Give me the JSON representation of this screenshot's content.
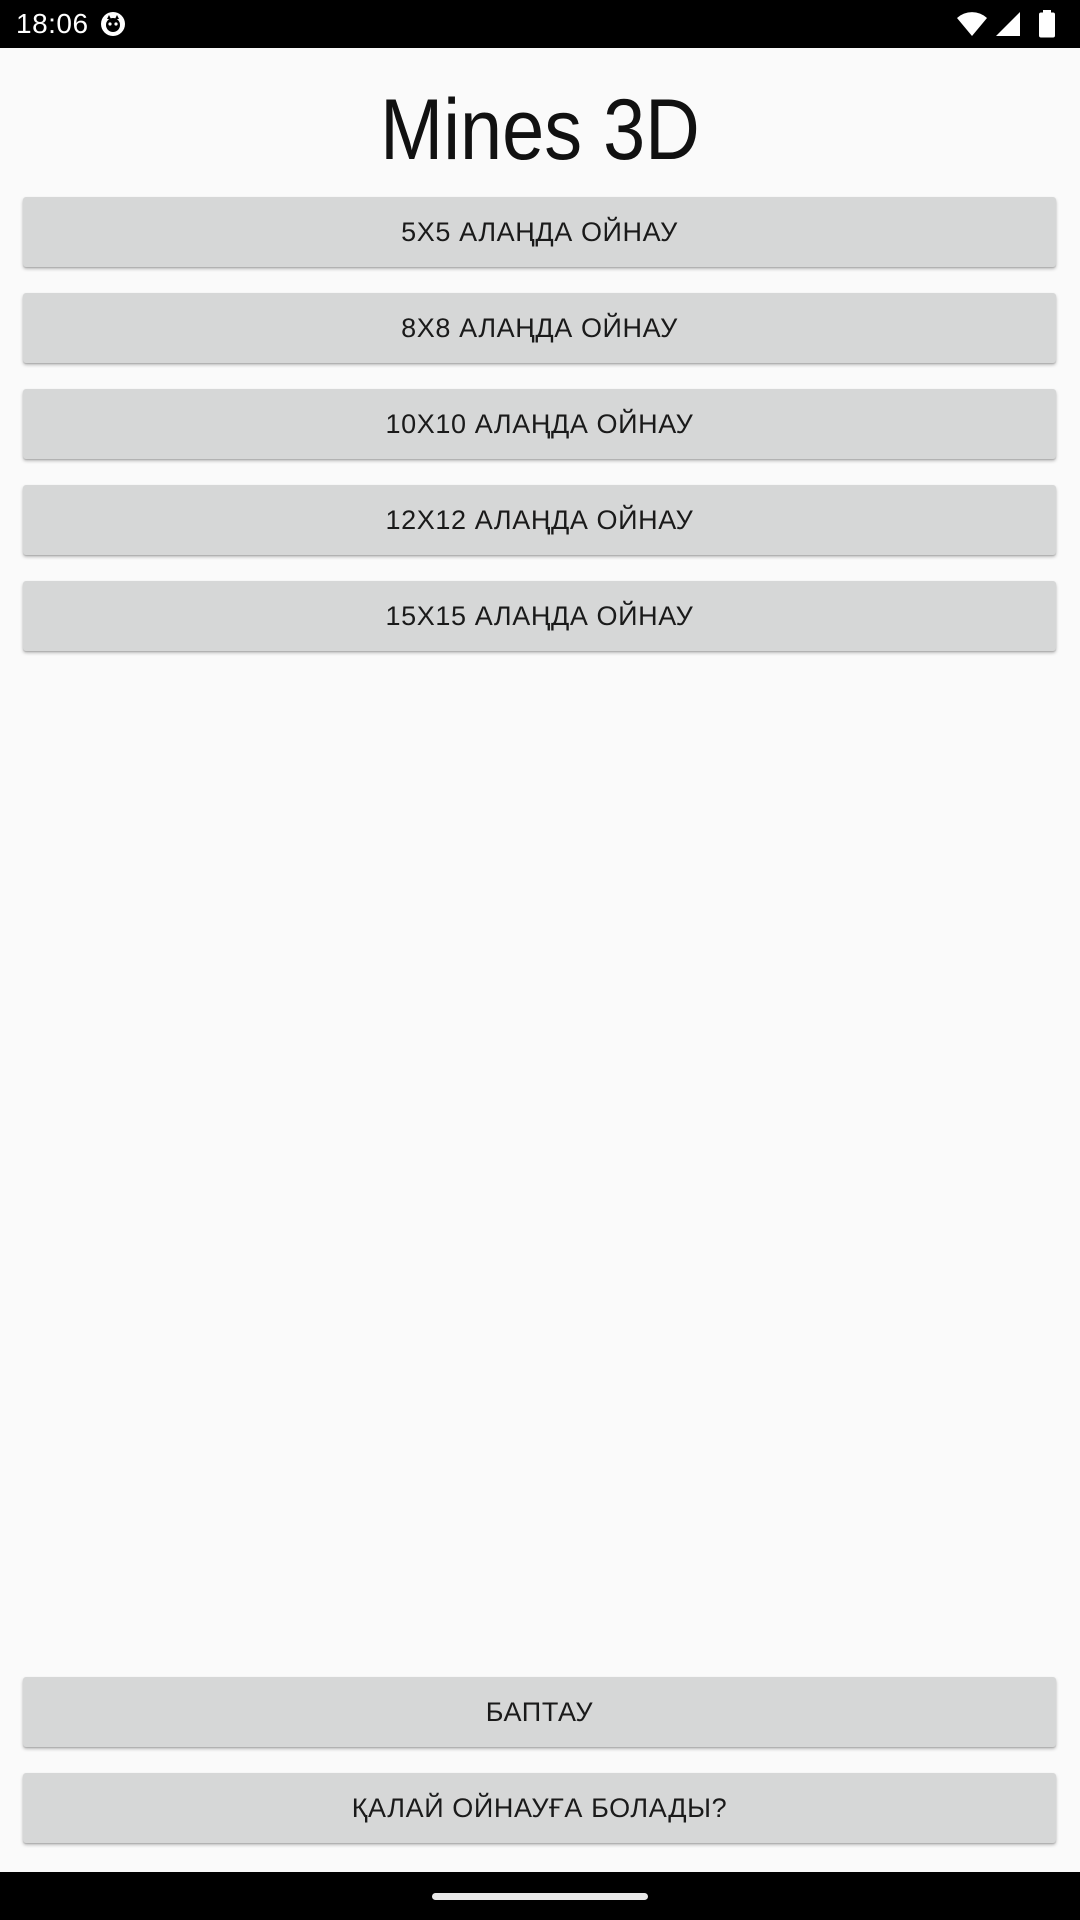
{
  "status_bar": {
    "time": "18:06",
    "icons": [
      "app-notification-icon",
      "wifi-icon",
      "signal-icon",
      "battery-icon"
    ]
  },
  "app": {
    "title": "Mines 3D"
  },
  "grid_buttons": [
    {
      "label": "5X5 АЛАҢДА ОЙНАУ"
    },
    {
      "label": "8X8 АЛАҢДА ОЙНАУ"
    },
    {
      "label": "10X10 АЛАҢДА ОЙНАУ"
    },
    {
      "label": "12X12 АЛАҢДА ОЙНАУ"
    },
    {
      "label": "15X15 АЛАҢДА ОЙНАУ"
    }
  ],
  "bottom_buttons": {
    "settings_label": "БАПТАУ",
    "help_label": "ҚАЛАЙ ОЙНАУҒА БОЛАДЫ?"
  },
  "colors": {
    "background": "#fafafa",
    "button": "#d6d7d7",
    "system_bars": "#000000"
  }
}
